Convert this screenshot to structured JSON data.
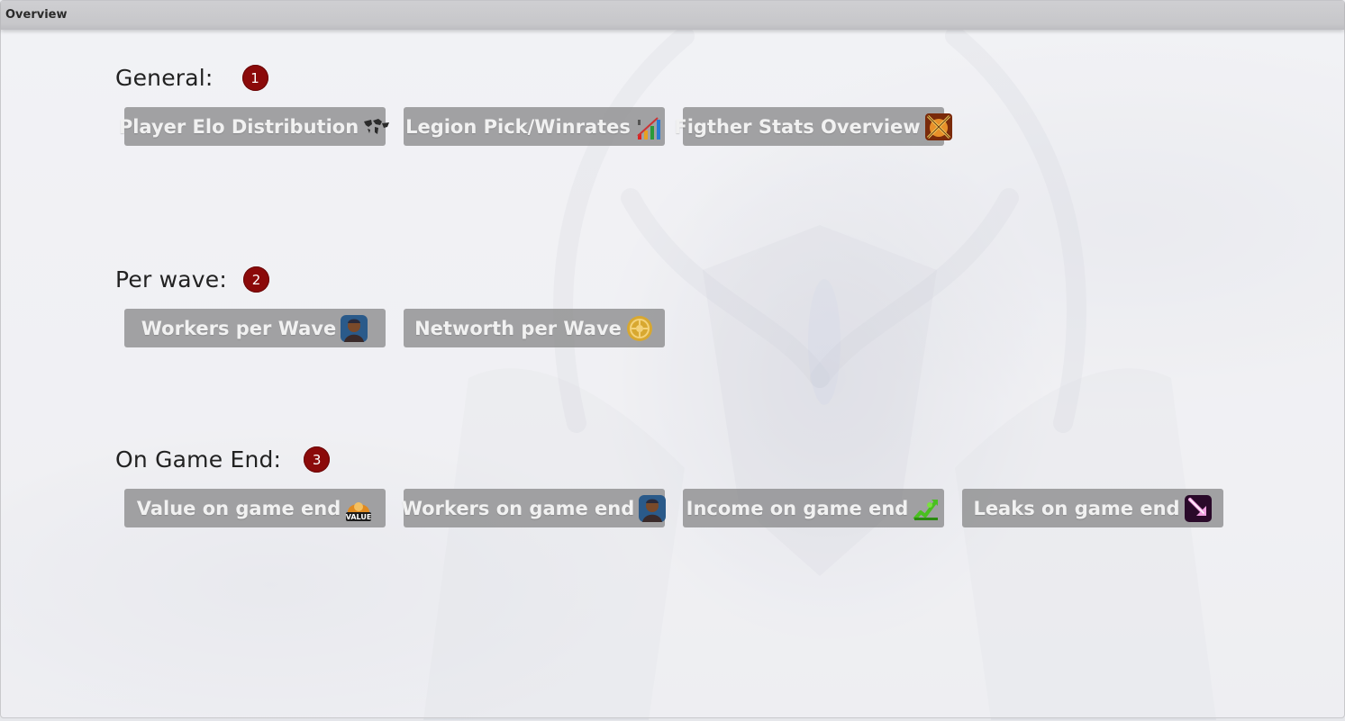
{
  "window": {
    "title": "Overview"
  },
  "sections": [
    {
      "title": "General:",
      "badge": "1",
      "buttons": [
        {
          "label": "Player Elo Distribution",
          "icon": "world-map-icon"
        },
        {
          "label": "Legion Pick/Winrates",
          "icon": "bar-chart-icon"
        },
        {
          "label": "Figther Stats Overview",
          "icon": "crossed-swords-icon"
        }
      ]
    },
    {
      "title": "Per wave:",
      "badge": "2",
      "buttons": [
        {
          "label": "Workers per Wave",
          "icon": "worker-portrait-icon"
        },
        {
          "label": "Networth per Wave",
          "icon": "gold-coin-icon"
        }
      ]
    },
    {
      "title": "On Game End:",
      "badge": "3",
      "buttons": [
        {
          "label": "Value on game end",
          "icon": "value-badge-icon",
          "icon_text": "VALUE"
        },
        {
          "label": "Workers on game end",
          "icon": "worker-portrait-icon"
        },
        {
          "label": "Income on game end",
          "icon": "income-growth-icon"
        },
        {
          "label": "Leaks on game end",
          "icon": "leak-arrow-icon"
        }
      ]
    }
  ],
  "colors": {
    "badge": "#8b0a0a",
    "button_bg": "#8a8a8c",
    "button_text": "#f1f1f1"
  }
}
